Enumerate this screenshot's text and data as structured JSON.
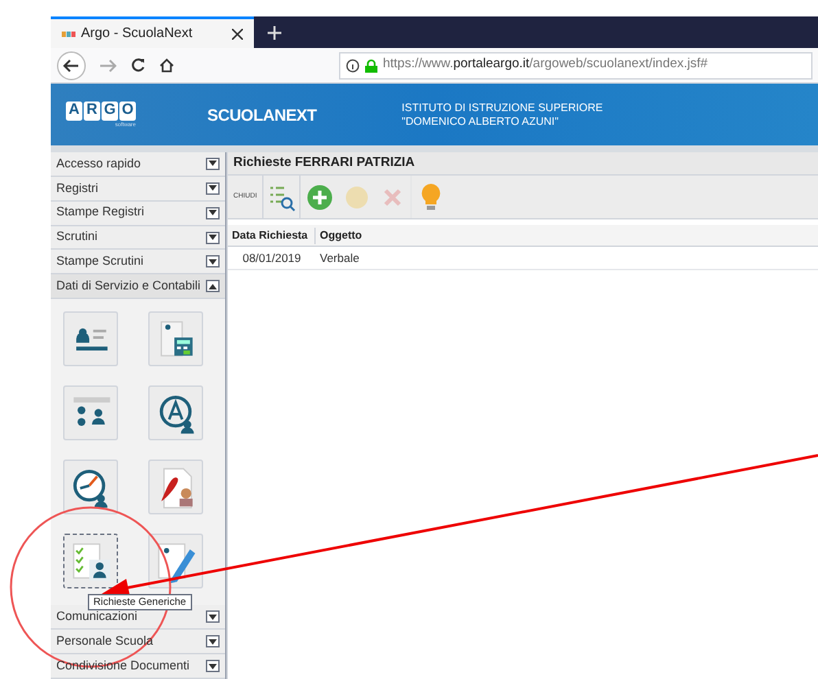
{
  "browser": {
    "tab_title": "Argo - ScuolaNext",
    "url_prefix": "https://www.",
    "url_domain": "portaleargo.it",
    "url_path": "/argoweb/scuolanext/index.jsf#"
  },
  "banner": {
    "logo": [
      "A",
      "R",
      "G",
      "O"
    ],
    "logo_sub": "software",
    "product": "SCUOLANEXT",
    "institute_line1": "ISTITUTO DI ISTRUZIONE SUPERIORE",
    "institute_line2": "\"DOMENICO ALBERTO AZUNI\""
  },
  "sidebar": {
    "sections_top": [
      {
        "label": "Accesso rapido",
        "expanded": false
      },
      {
        "label": "Registri",
        "expanded": false
      },
      {
        "label": "Stampe Registri",
        "expanded": false
      },
      {
        "label": "Scrutini",
        "expanded": false
      },
      {
        "label": "Stampe Scrutini",
        "expanded": false
      },
      {
        "label": "Dati di Servizio e Contabili",
        "expanded": true
      }
    ],
    "icons": [
      {
        "kind": "card",
        "selected": false
      },
      {
        "kind": "calculator",
        "selected": false
      },
      {
        "kind": "org",
        "selected": false
      },
      {
        "kind": "letter",
        "selected": false
      },
      {
        "kind": "gauge",
        "selected": false
      },
      {
        "kind": "pdf",
        "selected": false
      },
      {
        "kind": "checklist",
        "selected": true
      },
      {
        "kind": "edit",
        "selected": false
      }
    ],
    "tooltip": "Richieste Generiche",
    "sections_bottom": [
      {
        "label": "Comunicazioni",
        "expanded": false
      },
      {
        "label": "Personale Scuola",
        "expanded": false
      },
      {
        "label": "Condivisione Documenti",
        "expanded": false
      }
    ]
  },
  "panel": {
    "title": "Richieste FERRARI PATRIZIA",
    "toolbar": [
      {
        "kind": "close",
        "label": "CHIUDI",
        "disabled": false
      },
      {
        "kind": "view",
        "disabled": false
      },
      {
        "kind": "add",
        "disabled": false
      },
      {
        "kind": "edit",
        "disabled": true
      },
      {
        "kind": "delete",
        "disabled": true
      },
      {
        "kind": "hint",
        "disabled": false
      }
    ],
    "table": {
      "columns": [
        "Data Richiesta",
        "Oggetto"
      ],
      "rows": [
        [
          "08/01/2019",
          "Verbale"
        ]
      ]
    }
  }
}
